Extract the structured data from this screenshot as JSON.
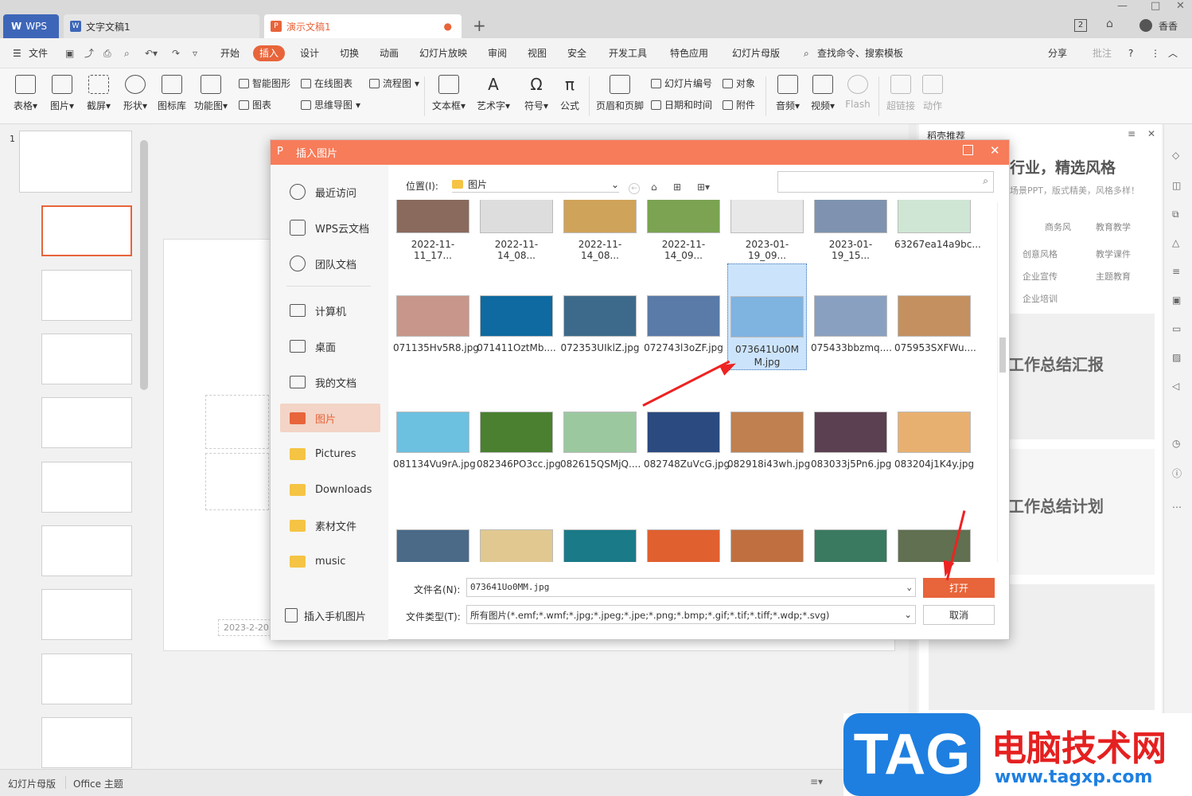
{
  "tabs": {
    "wps": "WPS",
    "doc": "文字文稿1",
    "ppt": "演示文稿1",
    "add": "+"
  },
  "menu": {
    "file": "文件",
    "items": [
      "开始",
      "插入",
      "设计",
      "切换",
      "动画",
      "幻灯片放映",
      "审阅",
      "视图",
      "安全",
      "开发工具",
      "特色应用",
      "幻灯片母版"
    ],
    "search": "查找命令、搜索模板",
    "share": "分享",
    "review": "批注"
  },
  "ribbon": {
    "table": "表格",
    "picture": "图片",
    "screenshot": "截屏",
    "shape": "形状",
    "iconlib": "图标库",
    "funcmap": "功能图",
    "smartart": "智能图形",
    "onlinechart": "在线图表",
    "flowchart": "流程图",
    "chart": "图表",
    "mindmap": "思维导图",
    "textbox": "文本框",
    "wordart": "艺术字",
    "symbol": "符号",
    "formula": "公式",
    "headerfooter": "页眉和页脚",
    "slidenum": "幻灯片编号",
    "object": "对象",
    "datetime": "日期和时间",
    "attachment": "附件",
    "audio": "音频",
    "video": "视频",
    "flash": "Flash",
    "hyperlink": "超链接",
    "action": "动作"
  },
  "pane": {
    "slide_num": "1",
    "date_placeholder": "2023-2-20",
    "recommend": "稻壳推荐",
    "banner": "行业，精选风格",
    "banner_sub": "场景PPT，版式精美，风格多样！",
    "categories": [
      "商务风",
      "教育教学",
      "创意风格",
      "教学课件",
      "企业宣传",
      "主题教育",
      "企业培训"
    ],
    "template1": "工作总结汇报",
    "template2": "工作总结计划"
  },
  "dialog": {
    "title": "插入图片",
    "location_label": "位置(I):",
    "location_value": "图片",
    "sidebar": [
      "最近访问",
      "WPS云文档",
      "团队文档",
      "计算机",
      "桌面",
      "我的文档",
      "图片",
      "Pictures",
      "Downloads",
      "素材文件",
      "music"
    ],
    "phone": "插入手机图片",
    "row1": [
      "2022-11-11_17...",
      "2022-11-14_08...",
      "2022-11-14_08...",
      "2022-11-14_09...",
      "2023-01-19_09...",
      "2023-01-19_15...",
      "63267ea14a9bc..."
    ],
    "row2": [
      "071135Hv5R8.jpg",
      "071411OztMb....",
      "072353UIklZ.jpg",
      "072743l3oZF.jpg",
      "073641Uo0MM.jpg",
      "075433bbzmq....",
      "075953SXFWu...."
    ],
    "row3": [
      "081134Vu9rA.jpg",
      "082346PO3cc.jpg",
      "082615QSMjQ....",
      "082748ZuVcG.jpg",
      "082918i43wh.jpg",
      "083033j5Pn6.jpg",
      "083204j1K4y.jpg"
    ],
    "filename_label": "文件名(N):",
    "filename_value": "073641Uo0MM.jpg",
    "filetype_label": "文件类型(T):",
    "filetype_value": "所有图片(*.emf;*.wmf;*.jpg;*.jpeg;*.jpe;*.png;*.bmp;*.gif;*.tif;*.tiff;*.wdp;*.svg)",
    "open": "打开",
    "cancel": "取消"
  },
  "status": {
    "master": "幻灯片母版",
    "theme": "Office 主题"
  },
  "watermark": {
    "tag": "TAG",
    "cn": "电脑技术网",
    "url": "www.tagxp.com"
  },
  "colors": {
    "accent": "#e8643a",
    "dialog_title": "#f77c5a",
    "wps_blue": "#3e66b8"
  }
}
